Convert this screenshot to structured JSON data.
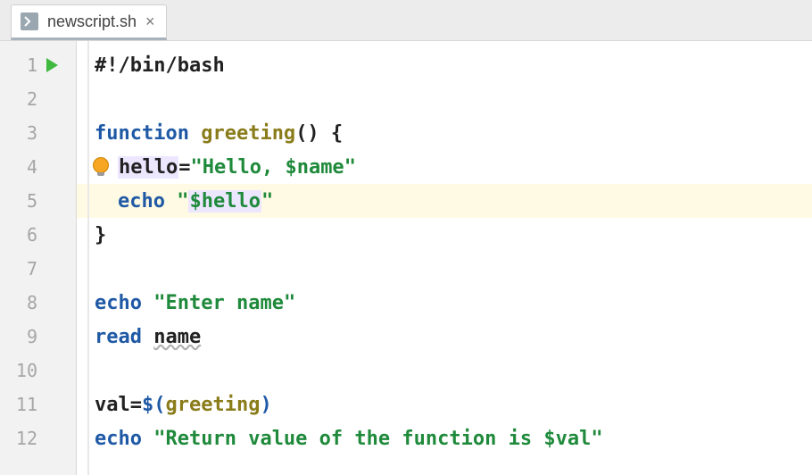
{
  "tab": {
    "filename": "newscript.sh",
    "close_glyph": "×"
  },
  "line_numbers": [
    "1",
    "2",
    "3",
    "4",
    "5",
    "6",
    "7",
    "8",
    "9",
    "10",
    "11",
    "12"
  ],
  "code": {
    "l1": {
      "shebang": "#!/bin/bash"
    },
    "l3": {
      "kw": "function",
      "fname": "greeting",
      "rest": "() {"
    },
    "l4": {
      "varname": "hello",
      "assign": "=",
      "q": "\"",
      "s1": "Hello, ",
      "var": "$name"
    },
    "l5": {
      "kw": "echo",
      "sp": " ",
      "q": "\"",
      "var": "$hello"
    },
    "l6": {
      "brace": "}"
    },
    "l8": {
      "kw": "echo",
      "sp": " ",
      "q": "\"",
      "s": "Enter name"
    },
    "l9": {
      "kw": "read",
      "sp": " ",
      "arg": "name"
    },
    "l11": {
      "var": "val",
      "assign": "=",
      "d1": "$(",
      "fn": "greeting",
      "d2": ")"
    },
    "l12": {
      "kw": "echo",
      "sp": " ",
      "q": "\"",
      "s": "Return value of the function is ",
      "var": "$val"
    }
  },
  "colors": {
    "keyword": "#1f59a5",
    "funcname": "#8a7c1a",
    "string": "#1f8a3b",
    "highlight_bg": "#fffae3",
    "var_usage_bg": "#ece6ff",
    "gutter_bg": "#f2f2f2"
  }
}
